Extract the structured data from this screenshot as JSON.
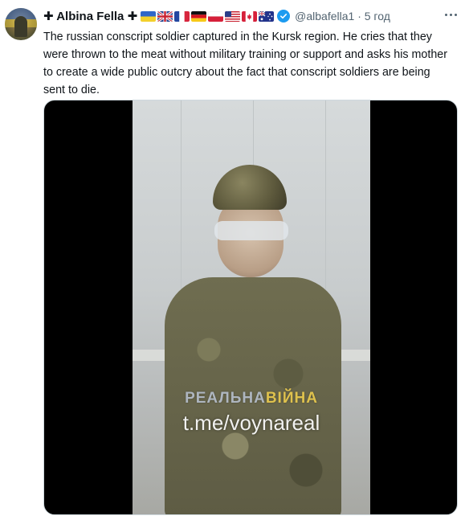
{
  "author": {
    "name": "Albina Fella",
    "name_prefix": "✚",
    "name_suffix": "✚",
    "flags": [
      "flag-ukraine",
      "flag-uk",
      "flag-france",
      "flag-germany",
      "flag-poland",
      "flag-usa",
      "flag-canada",
      "flag-australia"
    ],
    "handle": "@albafella1",
    "separator": "·",
    "time": "5 год",
    "verified": true
  },
  "tweet": {
    "text": "The russian conscript soldier captured in the Kursk region. He cries that they were thrown to the meat without military training or support and asks his mother to create a wide public outcry about the fact that conscript soldiers are being sent to die."
  },
  "media": {
    "watermark_part1": "РЕАЛЬНА",
    "watermark_part2": "ВІЙНА",
    "watermark_link": "t.me/voynareal"
  },
  "colors": {
    "verified": "#1d9bf0",
    "text_secondary": "#536471",
    "text_primary": "#0f1419"
  }
}
